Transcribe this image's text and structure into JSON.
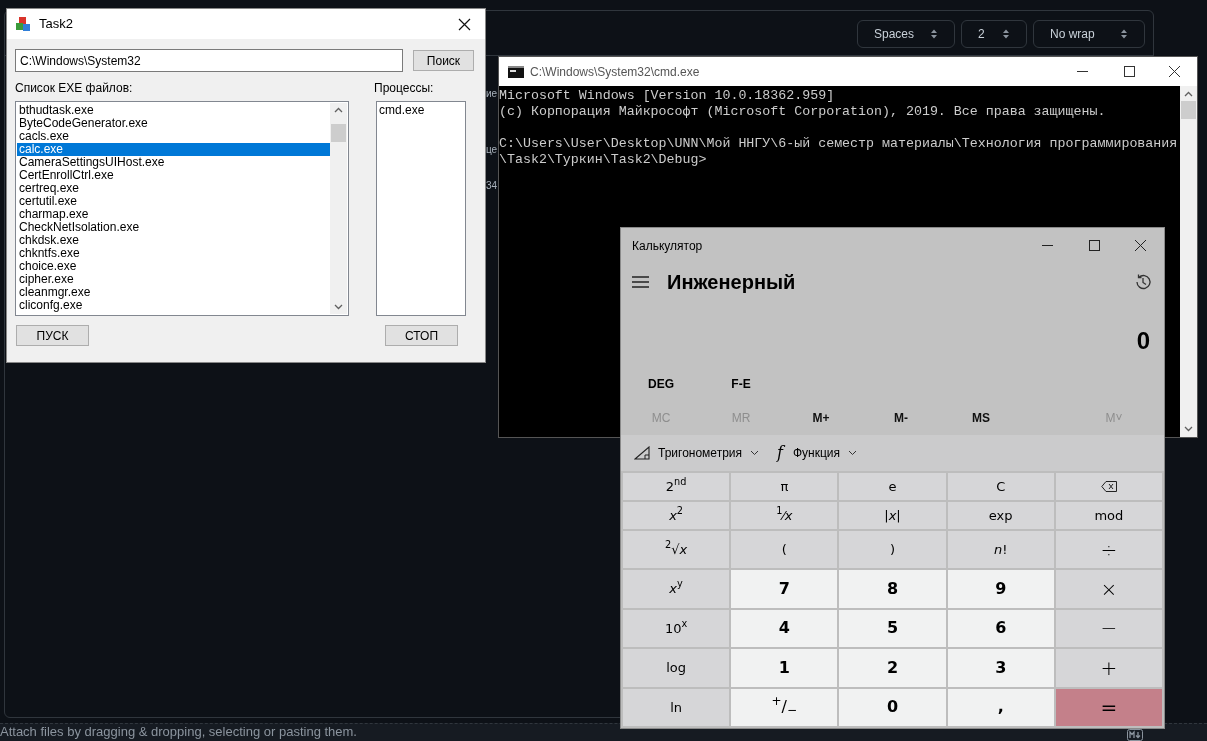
{
  "editor": {
    "selects": [
      {
        "label": "Spaces"
      },
      {
        "label": "2"
      },
      {
        "label": "No wrap"
      }
    ],
    "fragments": [
      "ие",
      "це",
      "34"
    ],
    "attach_hint": "Attach files by dragging & dropping, selecting or pasting them."
  },
  "task2": {
    "title": "Task2",
    "path": "C:\\Windows\\System32",
    "search_button": "Поиск",
    "exe_label": "Список EXE файлов:",
    "exe_files": [
      {
        "name": "bthudtask.exe",
        "selected": false
      },
      {
        "name": "ByteCodeGenerator.exe",
        "selected": false
      },
      {
        "name": "cacls.exe",
        "selected": false
      },
      {
        "name": "calc.exe",
        "selected": true
      },
      {
        "name": "CameraSettingsUIHost.exe",
        "selected": false
      },
      {
        "name": "CertEnrollCtrl.exe",
        "selected": false
      },
      {
        "name": "certreq.exe",
        "selected": false
      },
      {
        "name": "certutil.exe",
        "selected": false
      },
      {
        "name": "charmap.exe",
        "selected": false
      },
      {
        "name": "CheckNetIsolation.exe",
        "selected": false
      },
      {
        "name": "chkdsk.exe",
        "selected": false
      },
      {
        "name": "chkntfs.exe",
        "selected": false
      },
      {
        "name": "choice.exe",
        "selected": false
      },
      {
        "name": "cipher.exe",
        "selected": false
      },
      {
        "name": "cleanmgr.exe",
        "selected": false
      },
      {
        "name": "cliconfg.exe",
        "selected": false
      }
    ],
    "processes_label": "Процессы:",
    "processes": [
      "cmd.exe"
    ],
    "start_button": "ПУСК",
    "stop_button": "СТОП"
  },
  "cmd": {
    "title": "C:\\Windows\\System32\\cmd.exe",
    "blocks": [
      [
        "Microsoft Windows [Version 10.0.18362.959]",
        "(c) Корпорация Майкрософт (Microsoft Corporation), 2019. Все права защищены."
      ],
      [
        "C:\\Users\\User\\Desktop\\UNN\\Мой ННГУ\\6-ый семестр материалы\\Технология программирования",
        "\\Task2\\Туркин\\Task2\\Debug>"
      ]
    ]
  },
  "calculator": {
    "title": "Калькулятор",
    "mode": "Инженерный",
    "display": "0",
    "angle": "DEG",
    "notation": "F-E",
    "memory": [
      {
        "label": "MC",
        "disabled": true
      },
      {
        "label": "MR",
        "disabled": true
      },
      {
        "label": "M+",
        "disabled": false
      },
      {
        "label": "M-",
        "disabled": false
      },
      {
        "label": "MS",
        "disabled": false
      },
      {
        "label": "M˅",
        "disabled": true
      }
    ],
    "toolbar": [
      {
        "kind": "icon",
        "label": "Тригонометрия"
      },
      {
        "kind": "glyph",
        "glyph": "f",
        "label": "Функция"
      }
    ],
    "keys": [
      {
        "kind": "function",
        "label": "2$^{nd}$"
      },
      {
        "kind": "function",
        "label": "π"
      },
      {
        "kind": "function",
        "label": "e"
      },
      {
        "kind": "function",
        "label": "C"
      },
      {
        "kind": "backspace"
      },
      {
        "kind": "function",
        "label": "*x*$^{2}$"
      },
      {
        "kind": "function",
        "label": "$^{1}$⁄*x*"
      },
      {
        "kind": "function",
        "label": "|*x*|"
      },
      {
        "kind": "function",
        "label": "exp"
      },
      {
        "kind": "function",
        "label": "mod"
      },
      {
        "kind": "function",
        "label": "$^{2}$√*x*"
      },
      {
        "kind": "function",
        "label": "("
      },
      {
        "kind": "function",
        "label": ")"
      },
      {
        "kind": "function",
        "label": "*n*!"
      },
      {
        "kind": "operator",
        "label": "÷"
      },
      {
        "kind": "function",
        "label": "*x*$^{y}$"
      },
      {
        "kind": "digit",
        "label": "7"
      },
      {
        "kind": "digit",
        "label": "8"
      },
      {
        "kind": "digit",
        "label": "9"
      },
      {
        "kind": "operator",
        "label": "×"
      },
      {
        "kind": "function",
        "label": "10$^{x}$"
      },
      {
        "kind": "digit",
        "label": "4"
      },
      {
        "kind": "digit",
        "label": "5"
      },
      {
        "kind": "digit",
        "label": "6"
      },
      {
        "kind": "operator",
        "label": "−"
      },
      {
        "kind": "function",
        "label": "log"
      },
      {
        "kind": "digit",
        "label": "1"
      },
      {
        "kind": "digit",
        "label": "2"
      },
      {
        "kind": "digit",
        "label": "3"
      },
      {
        "kind": "operator",
        "label": "+"
      },
      {
        "kind": "function",
        "label": "ln"
      },
      {
        "kind": "digit",
        "label": "$^{+}$/$_{−}$"
      },
      {
        "kind": "digit",
        "label": "0"
      },
      {
        "kind": "digit",
        "label": ","
      },
      {
        "kind": "equals",
        "label": "="
      }
    ]
  }
}
